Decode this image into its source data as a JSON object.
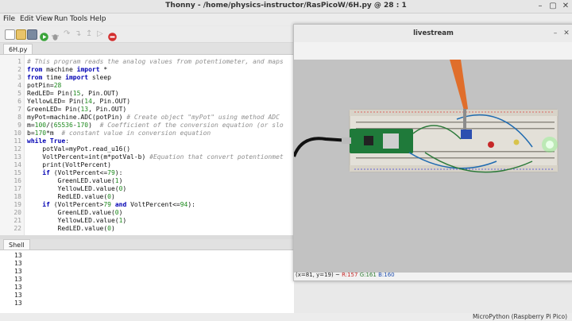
{
  "window": {
    "title": "Thonny - /home/physics-instructor/RasPicoW/6H.py @ 28 : 1"
  },
  "menu": [
    "File",
    "Edit",
    "View",
    "Run",
    "Tools",
    "Help"
  ],
  "editor": {
    "tab": "6H.py",
    "lines": [
      {
        "n": "1",
        "html": "<span class=\"cm\"># This program reads the analog values from potentiometer, and maps</span>"
      },
      {
        "n": "2",
        "html": "<span class=\"kw\">from</span> machine <span class=\"kw\">import</span> *"
      },
      {
        "n": "3",
        "html": "<span class=\"kw\">from</span> time <span class=\"kw\">import</span> sleep"
      },
      {
        "n": "4",
        "html": "potPin=<span class=\"nm\">28</span>"
      },
      {
        "n": "5",
        "html": "RedLED= Pin(<span class=\"nm\">15</span>, Pin.OUT)"
      },
      {
        "n": "6",
        "html": "YellowLED= Pin(<span class=\"nm\">14</span>, Pin.OUT)"
      },
      {
        "n": "7",
        "html": "GreenLED= Pin(<span class=\"nm\">13</span>, Pin.OUT)"
      },
      {
        "n": "8",
        "html": "myPot=machine.ADC(potPin) <span class=\"cm\"># Create object \"myPot\" using method ADC</span>"
      },
      {
        "n": "9",
        "html": "m=<span class=\"nm\">100</span>/(<span class=\"nm\">65536</span>-<span class=\"nm\">170</span>)  <span class=\"cm\"># Coefficient of the conversion equation (or slo</span>"
      },
      {
        "n": "10",
        "html": "b=<span class=\"nm\">170</span>*m  <span class=\"cm\"># constant value in conversion equation</span>"
      },
      {
        "n": "11",
        "html": "<span class=\"kw\">while</span> <span class=\"kw\">True</span>:"
      },
      {
        "n": "12",
        "html": "    potVal=myPot.read_u16()"
      },
      {
        "n": "13",
        "html": "    VoltPercent=int(m*potVal-b) <span class=\"cm\">#Equation that convert potentionmet</span>"
      },
      {
        "n": "14",
        "html": "    print(VoltPercent)"
      },
      {
        "n": "15",
        "html": "    <span class=\"kw\">if</span> (VoltPercent&lt;=<span class=\"nm\">79</span>):"
      },
      {
        "n": "16",
        "html": "        GreenLED.value(<span class=\"nm\">1</span>)"
      },
      {
        "n": "17",
        "html": "        YellowLED.value(<span class=\"nm\">0</span>)"
      },
      {
        "n": "18",
        "html": "        RedLED.value(<span class=\"nm\">0</span>)"
      },
      {
        "n": "19",
        "html": "    <span class=\"kw\">if</span> (VoltPercent&gt;<span class=\"nm\">79</span> <span class=\"kw\">and</span> VoltPercent&lt;=<span class=\"nm\">94</span>):"
      },
      {
        "n": "20",
        "html": "        GreenLED.value(<span class=\"nm\">0</span>)"
      },
      {
        "n": "21",
        "html": "        YellowLED.value(<span class=\"nm\">1</span>)"
      },
      {
        "n": "22",
        "html": "        RedLED.value(<span class=\"nm\">0</span>)"
      }
    ]
  },
  "shell": {
    "tab": "Shell",
    "output": [
      "13",
      "13",
      "13",
      "13",
      "13",
      "13",
      "13"
    ]
  },
  "statusbar": {
    "interpreter": "MicroPython (Raspberry Pi Pico)"
  },
  "livestream": {
    "title": "livestream",
    "readout": {
      "coords": "(x=81, y=19) ~",
      "r": "R:157",
      "g": "G:161",
      "b": "B:160"
    }
  }
}
